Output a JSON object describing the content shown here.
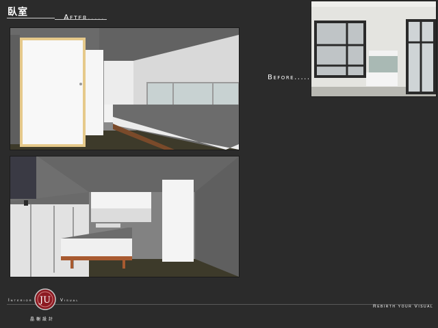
{
  "header": {
    "title": "臥室",
    "after_label": "After.....",
    "before_label": "Before....."
  },
  "footer": {
    "interior": "Interior",
    "visual": "Visual",
    "tagline": "Rebirth your Visual",
    "company": "晶榭設計",
    "logo_text": "JU"
  },
  "colors": {
    "background": "#2b2b2b",
    "logo_red": "#8c1a22"
  }
}
